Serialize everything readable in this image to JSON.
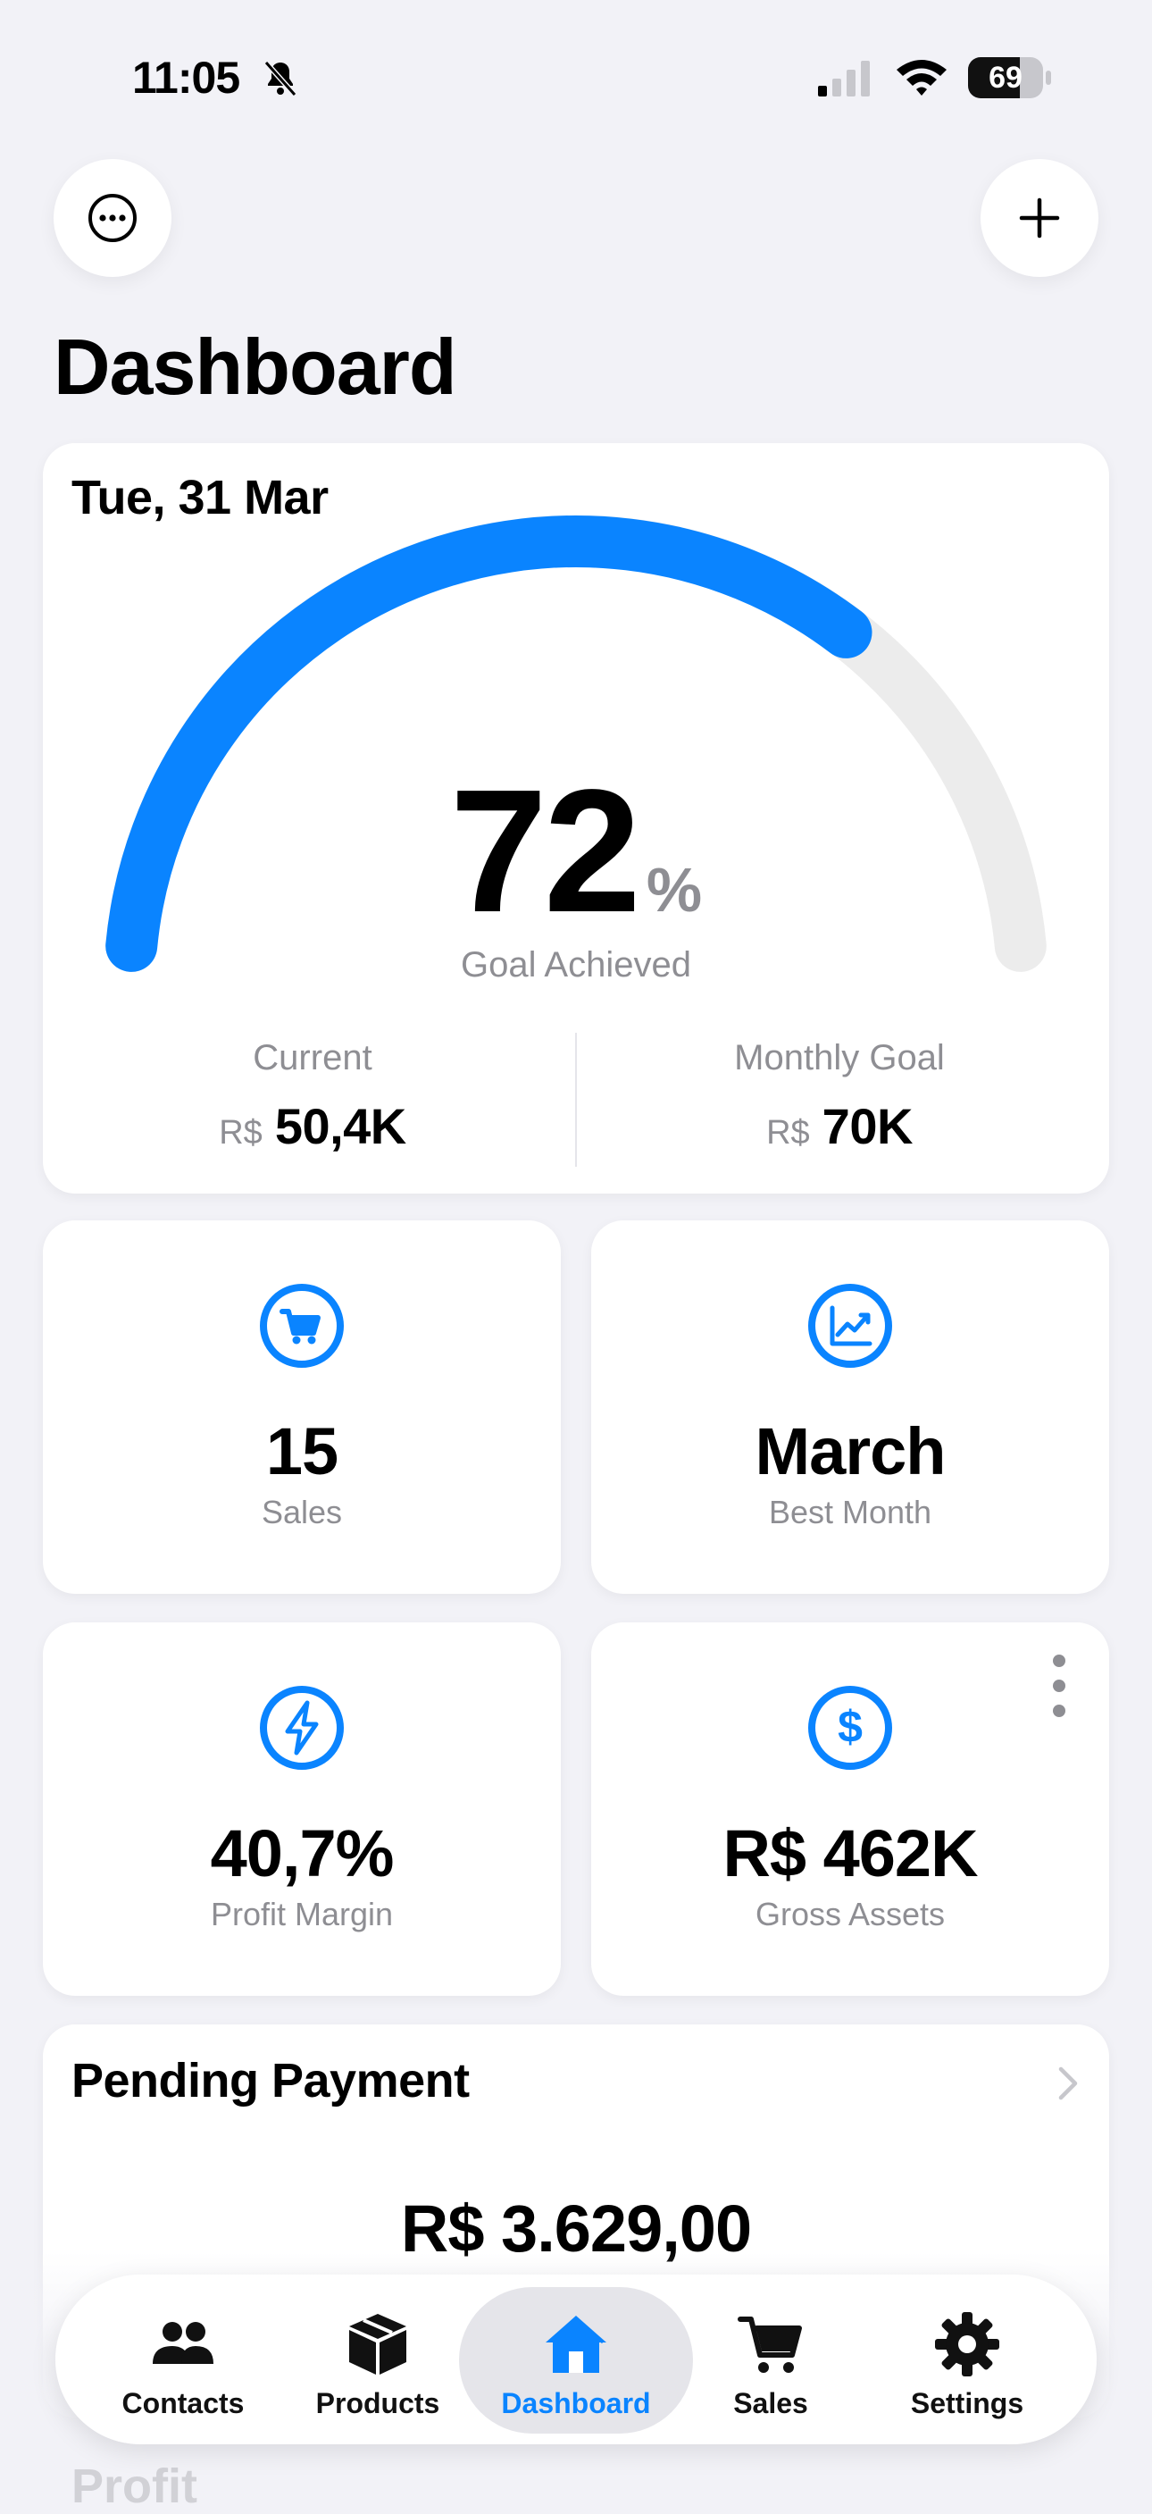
{
  "status_bar": {
    "time": "11:05",
    "battery": "69",
    "battery_level": 0.69
  },
  "header": {
    "title": "Dashboard",
    "more_icon": "ellipsis-circle-icon",
    "add_icon": "plus-icon"
  },
  "goal_card": {
    "date": "Tue, 31 Mar",
    "percent": "72",
    "percent_symbol": "%",
    "progress": 0.72,
    "caption": "Goal Achieved",
    "current": {
      "label": "Current",
      "currency": "R$",
      "amount": "50,4K"
    },
    "monthly_goal": {
      "label": "Monthly Goal",
      "currency": "R$",
      "amount": "70K"
    }
  },
  "metrics": [
    {
      "value": "15",
      "label": "Sales",
      "icon": "cart-icon"
    },
    {
      "value": "March",
      "label": "Best Month",
      "icon": "chart-up-icon"
    },
    {
      "value": "40,7%",
      "label": "Profit Margin",
      "icon": "bolt-icon"
    },
    {
      "value": "R$ 462K",
      "label": "Gross Assets",
      "icon": "dollar-icon"
    }
  ],
  "pending": {
    "title": "Pending Payment",
    "amount": "R$ 3.629,00"
  },
  "next_section_peek": "Profit",
  "tabbar": {
    "tabs": [
      {
        "label": "Contacts",
        "icon": "people-icon"
      },
      {
        "label": "Products",
        "icon": "box-icon"
      },
      {
        "label": "Dashboard",
        "icon": "house-icon",
        "active": true
      },
      {
        "label": "Sales",
        "icon": "cart-icon"
      },
      {
        "label": "Settings",
        "icon": "gear-icon"
      }
    ]
  },
  "colors": {
    "accent": "#0a84ff",
    "track": "#ececec",
    "background": "#f2f2f7",
    "secondary_text": "#8e8e93"
  }
}
